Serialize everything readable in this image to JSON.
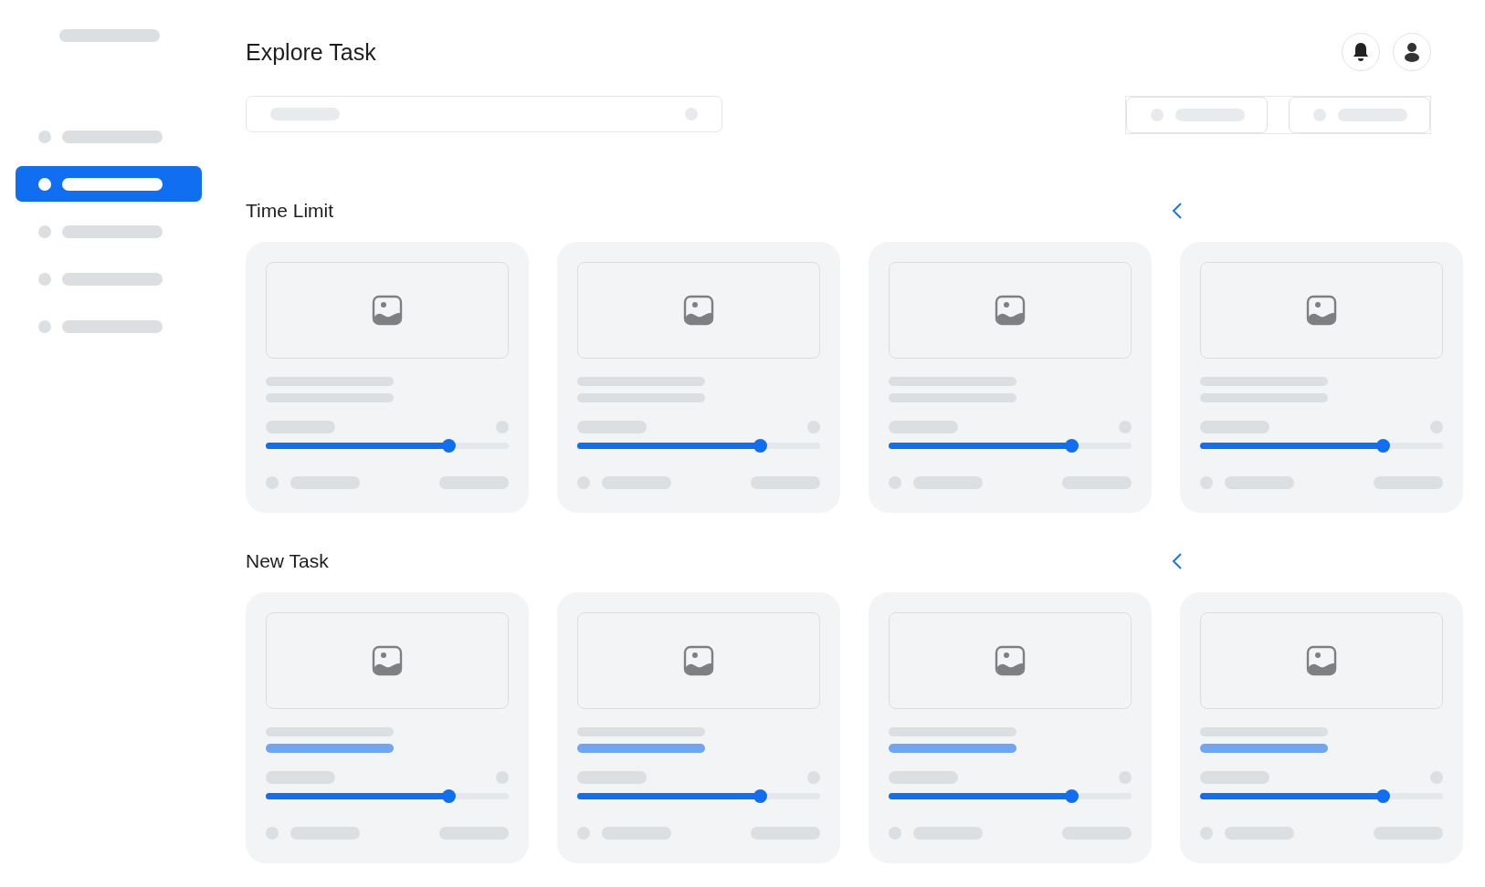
{
  "sidebar": {
    "items": [
      {
        "selected": false
      },
      {
        "selected": true
      },
      {
        "selected": false
      },
      {
        "selected": false
      },
      {
        "selected": false
      }
    ]
  },
  "header": {
    "title": "Explore Task"
  },
  "sections": [
    {
      "title": "Time Limit",
      "cards": [
        {
          "level": 0.75,
          "subtitle_highlighted": false
        },
        {
          "level": 0.75,
          "subtitle_highlighted": false
        },
        {
          "level": 0.75,
          "subtitle_highlighted": false
        },
        {
          "level": 0.75,
          "subtitle_highlighted": false
        }
      ]
    },
    {
      "title": "New Task",
      "cards": [
        {
          "level": 0.75,
          "subtitle_highlighted": true
        },
        {
          "level": 0.75,
          "subtitle_highlighted": true
        },
        {
          "level": 0.75,
          "subtitle_highlighted": true
        },
        {
          "level": 0.75,
          "subtitle_highlighted": true
        }
      ]
    }
  ]
}
